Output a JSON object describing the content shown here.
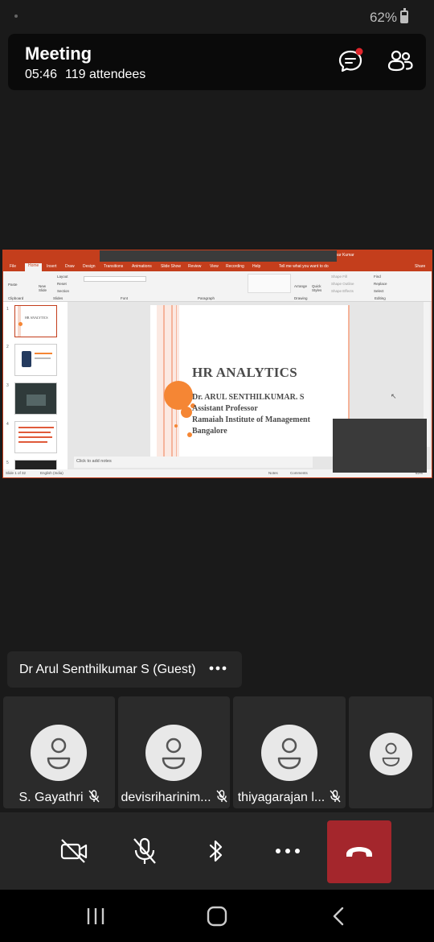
{
  "status_bar": {
    "battery_percent": "62%",
    "battery_level": 0.62
  },
  "header": {
    "title": "Meeting",
    "duration": "05:46",
    "attendees": "119 attendees",
    "chat_icon": "chat-bubble-icon",
    "chat_unread_color": "#e0252c",
    "people_icon": "people-icon"
  },
  "shared_screen": {
    "app": "PowerPoint",
    "accent_color": "#c43e1c",
    "tabs": [
      "File",
      "Home",
      "Insert",
      "Draw",
      "Design",
      "Transitions",
      "Animations",
      "Slide Show",
      "Review",
      "View",
      "Recording",
      "Help"
    ],
    "tell_me": "Tell me what you want to do",
    "user": "mar Kumar",
    "share_label": "Share",
    "ribbon": {
      "paste": "Paste",
      "new_slide": "New Slide",
      "layout": "Layout",
      "reset": "Reset",
      "section": "Section",
      "arrange": "Arrange",
      "quick_styles": "Quick Styles",
      "shape_fill": "Shape Fill",
      "shape_outline": "Shape Outline",
      "shape_effects": "Shape Effects",
      "find": "Find",
      "replace": "Replace",
      "select": "Select",
      "groups": [
        "Clipboard",
        "Slides",
        "Font",
        "Paragraph",
        "Drawing",
        "Editing"
      ]
    },
    "thumbnails": [
      "1",
      "2",
      "3",
      "4",
      "5"
    ],
    "slide": {
      "title": "HR ANALYTICS",
      "lines": [
        "Dr. ARUL SENTHILKUMAR. S",
        "Assistant Professor",
        "Ramaiah Institute of Management",
        "Bangalore"
      ]
    },
    "notes_placeholder": "Click to add notes",
    "status": {
      "slide_count": "Slide 1 of 32",
      "language": "English (India)",
      "notes": "Notes",
      "comments": "Comments",
      "zoom": "63%"
    }
  },
  "presenter": {
    "name": "Dr Arul Senthilkumar S (Guest)",
    "more_icon": "more-options-icon"
  },
  "participants": [
    {
      "name": "S. Gayathri",
      "muted": true
    },
    {
      "name": "devisriharinim...",
      "muted": true
    },
    {
      "name": "thiyagarajan l...",
      "muted": true
    },
    {
      "name": "",
      "muted": false
    }
  ],
  "controls": {
    "camera_icon": "camera-off-icon",
    "mic_icon": "mic-off-icon",
    "bluetooth_icon": "bluetooth-icon",
    "more_icon": "more-options-icon",
    "hangup_icon": "hang-up-icon",
    "hangup_color": "#a4262c"
  },
  "navbar": {
    "recents_icon": "recents-icon",
    "home_icon": "home-icon",
    "back_icon": "back-icon"
  }
}
